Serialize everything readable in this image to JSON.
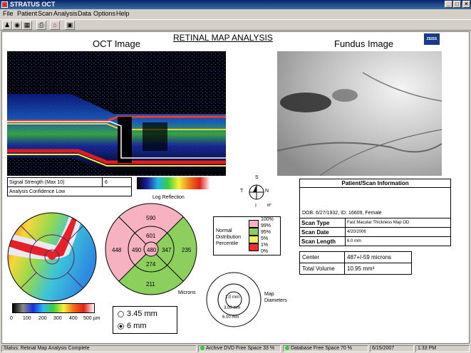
{
  "window": {
    "title": "STRATUS OCT",
    "min": "_",
    "max": "□",
    "close": "×"
  },
  "menu": [
    "File",
    "Patient",
    "Scan",
    "Analysis",
    "Data",
    "Options",
    "Help"
  ],
  "toolbar_icons": [
    "patients-icon",
    "eye-icon",
    "scan-icon",
    "print-icon",
    "home-icon",
    "exit-icon"
  ],
  "report": {
    "title": "RETINAL MAP ANALYSIS",
    "oct_heading": "OCT Image",
    "fundus_heading": "Fundus Image",
    "brand": "ZEISS",
    "signal_label": "Signal Strength (Max 10)",
    "signal_value": "6",
    "confidence": "Analysis Confidence Low",
    "log_reflection": "Log Reflection",
    "orientation": {
      "s": "S",
      "t": "T",
      "n": "N",
      "i": "I",
      "extra": "M°"
    }
  },
  "thickness_scale": {
    "ticks": [
      "0",
      "100",
      "200",
      "300",
      "400",
      "500 µm"
    ]
  },
  "sector_map": {
    "outer": {
      "top": "590",
      "left": "448",
      "right": "235",
      "bottom": "211"
    },
    "inner": {
      "top": "601",
      "left": "490",
      "right": "347",
      "bottom": "274"
    },
    "center": "480",
    "units": "Microns"
  },
  "normal_distribution": {
    "label_1": "Normal",
    "label_2": "Distribution",
    "label_3": "Percentile",
    "levels": [
      "100%",
      "99%",
      "95%",
      "5%",
      "1%",
      "0%"
    ],
    "colors": [
      "#f5b6c0",
      "#8fce5e",
      "#f2f058",
      "#e83030"
    ]
  },
  "diameters": {
    "inner": "1.0 mm",
    "middle": "3.00 mm",
    "outer": "6.00 mm",
    "label_1": "Map",
    "label_2": "Diameters"
  },
  "size_options": {
    "option_1": "3.45 mm",
    "option_2": "6 mm",
    "selected": "6 mm"
  },
  "patient_info": {
    "header": "Patient/Scan Information",
    "dob_line": "DOB: 6/27/1932, ID: 16609, Female",
    "rows": [
      {
        "label": "Scan Type",
        "value": "Fast Macular Thickness Map  OD"
      },
      {
        "label": "Scan Date",
        "value": "4/20/2006"
      },
      {
        "label": "Scan Length",
        "value": "6.0 mm"
      }
    ]
  },
  "measurements": [
    {
      "label": "Center",
      "value": "487+/-59 microns"
    },
    {
      "label": "Total Volume",
      "value": "10.95 mm³"
    }
  ],
  "status": {
    "text": "Status: Retinal Map Analysis Complete",
    "archive": "Archive DVD Free Space 33 %",
    "database": "Database Free Space 70 %",
    "date": "6/15/2007",
    "time": "1:33 PM"
  }
}
